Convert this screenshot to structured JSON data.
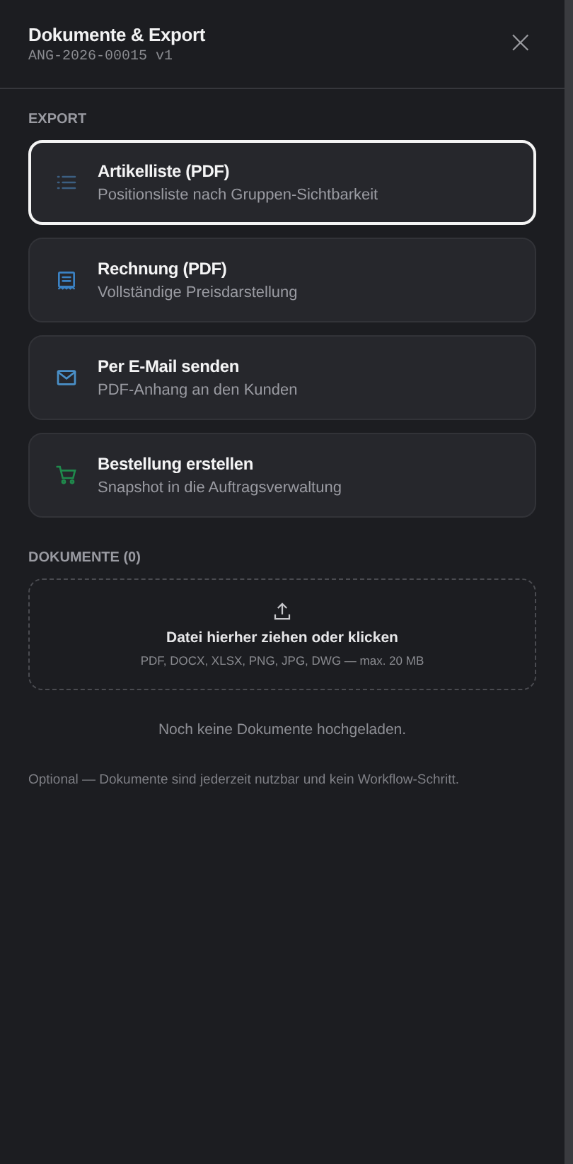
{
  "header": {
    "title": "Dokumente & Export",
    "subtitle": "ANG-2026-00015 v1",
    "close": "×"
  },
  "export": {
    "heading": "EXPORT",
    "actions": [
      {
        "kind": "list",
        "title": "Artikelliste (PDF)",
        "description": "Positionsliste nach Gruppen-Sichtbarkeit",
        "focused": true,
        "color": "#3c5f82"
      },
      {
        "kind": "receipt",
        "title": "Rechnung (PDF)",
        "description": "Vollständige Preisdarstellung",
        "focused": false,
        "color": "#3b82c4"
      },
      {
        "kind": "mail",
        "title": "Per E-Mail senden",
        "description": "PDF-Anhang an den Kunden",
        "focused": false,
        "color": "#4a90c8"
      },
      {
        "kind": "cart",
        "title": "Bestellung erstellen",
        "description": "Snapshot in die Auftragsverwaltung",
        "focused": false,
        "color": "#1f8a4c"
      }
    ]
  },
  "documents": {
    "heading": "DOKUMENTE (0)",
    "dropzone": {
      "title": "Datei hierher ziehen oder klicken",
      "hint": "PDF, DOCX, XLSX, PNG, JPG, DWG — max. 20 MB"
    },
    "empty": "Noch keine Dokumente hochgeladen.",
    "note": "Optional — Dokumente sind jederzeit nutzbar und kein Workflow-Schritt."
  }
}
